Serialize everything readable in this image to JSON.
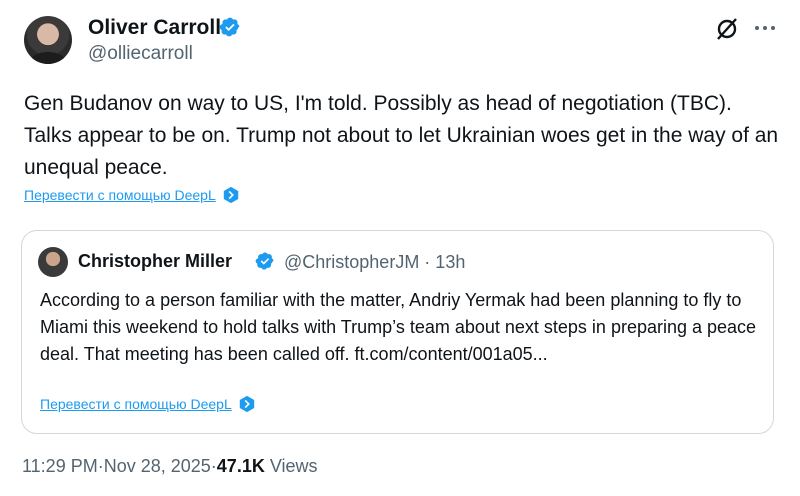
{
  "author": {
    "name": "Oliver Carroll",
    "handle": "@olliecarroll",
    "verified": true
  },
  "tweet": {
    "text": "Gen Budanov on way to US, I'm told. Possibly as head of negotiation (TBC). Talks appear to be on. Trump not about to let Ukrainian woes get in the way of an unequal peace."
  },
  "translate_label": "Перевести с помощью DeepL",
  "quote": {
    "name": "Christopher Miller",
    "handle_time": "@ChristopherJM · 13h",
    "text": "According to a person familiar with the matter, Andriy Yermak had been planning to fly to Miami this weekend to hold talks with Trump’s team about next steps in preparing a peace deal. That meeting has been called off. ft.com/content/001a05...",
    "translate_label": "Перевести с помощью DeepL"
  },
  "meta": {
    "time": "11:29 PM",
    "sep1": " · ",
    "date": "Nov 28, 2025",
    "sep2": " · ",
    "views_count": "47.1K",
    "views_label": " Views"
  },
  "icons": {
    "grok": "grok-icon",
    "more": "more-icon",
    "verified": "verified-badge-icon",
    "deepl": "deepl-icon"
  },
  "colors": {
    "accent": "#1d9bf0",
    "text": "#0f1419",
    "secondary": "#536471",
    "border": "#cfd9de"
  }
}
